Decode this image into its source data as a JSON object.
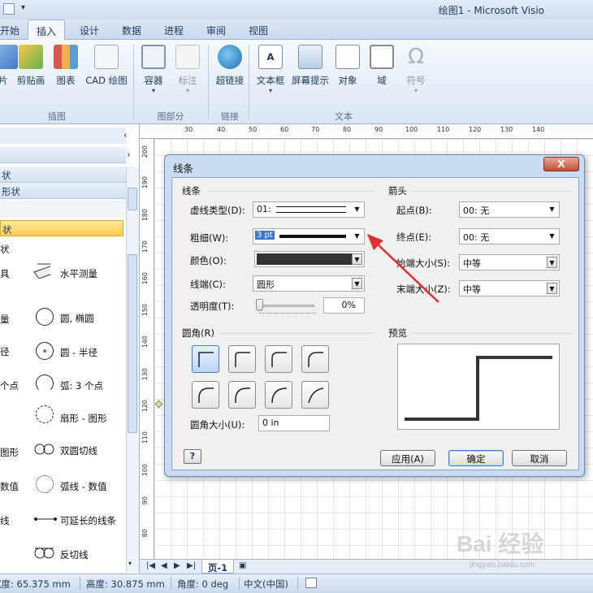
{
  "window": {
    "title": "绘图1 - Microsoft Visio"
  },
  "tabs": [
    "开始",
    "插入",
    "设计",
    "数据",
    "进程",
    "审阅",
    "视图"
  ],
  "ribbon": {
    "buttons": [
      "片",
      "剪贴画",
      "图表",
      "CAD 绘图",
      "容器",
      "标注",
      "超链接",
      "文本框",
      "屏幕提示",
      "对象",
      "域",
      "符号"
    ],
    "groups": [
      "插图",
      "图部分",
      "链接",
      "文本"
    ]
  },
  "panel": {
    "headers": [
      "状",
      "形状",
      "状",
      "状"
    ],
    "shapes": [
      "具",
      "水平测量",
      "量",
      "圆, 椭圆",
      "径",
      "圆 - 半径",
      "个点",
      "弧: 3 个点",
      "扇形 - 图形",
      "图形",
      "双圆切线",
      "数值",
      "弧线 - 数值",
      "线",
      "可延长的线条",
      "反切线"
    ]
  },
  "ruler": {
    "top": [
      "30",
      "40",
      "50",
      "60",
      "70",
      "80",
      "90",
      "100",
      "110",
      "120",
      "130",
      "140"
    ],
    "left": [
      "200",
      "190",
      "180",
      "170",
      "160",
      "150",
      "140",
      "130",
      "120",
      "110",
      "100",
      "90",
      "80"
    ]
  },
  "pagebar": {
    "page_tab": "页-1"
  },
  "status": {
    "width": "宽度: 65.375 mm",
    "height": "高度: 30.875 mm",
    "angle": "角度: 0 deg",
    "lang": "中文(中国)"
  },
  "dialog": {
    "title": "线条",
    "close": "X",
    "line_section": "线条",
    "dash_label": "虚线类型(D):",
    "dash_value": "01:",
    "weight_label": "粗细(W):",
    "weight_value": "3 pt",
    "color_label": "颜色(O):",
    "cap_label": "线端(C):",
    "cap_value": "圆形",
    "transparency_label": "透明度(T):",
    "transparency_value": "0%",
    "transparency": 0,
    "arrow_section": "箭头",
    "begin_label": "起点(B):",
    "begin_value": "00: 无",
    "end_label": "终点(E):",
    "end_value": "00: 无",
    "begin_size_label": "始端大小(S):",
    "begin_size_value": "中等",
    "end_size_label": "末端大小(Z):",
    "end_size_value": "中等",
    "corner_section": "圆角(R)",
    "corner_size_label": "圆角大小(U):",
    "corner_size_value": "0 in",
    "preview_section": "预览",
    "help": "?",
    "apply": "应用(A)",
    "ok": "确定",
    "cancel": "取消"
  },
  "watermark": {
    "brand": "Bai 经验",
    "url": "jingyan.baidu.com"
  },
  "colors": {
    "accent_blue": "#3c7fd1",
    "annotation_red": "#e03030",
    "selected_header": "#f9cd4f"
  }
}
